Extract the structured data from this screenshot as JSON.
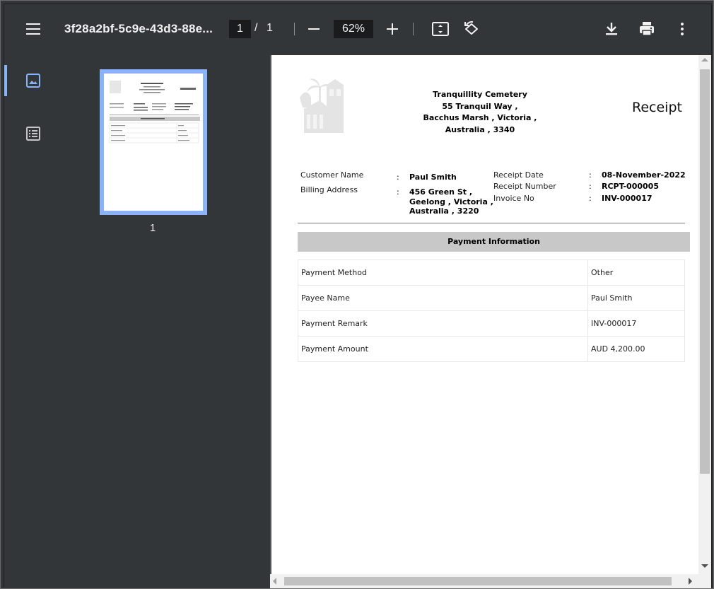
{
  "toolbar": {
    "title": "3f28a2bf-5c9e-43d3-88e...",
    "current_page": "1",
    "page_separator": "/",
    "total_pages": "1",
    "zoom": "62%"
  },
  "sidebar": {
    "thumbnail_page_number": "1"
  },
  "receipt": {
    "company_lines": [
      "Tranquillity Cemetery",
      "55 Tranquil Way ,",
      "Bacchus Marsh , Victoria ,",
      "Australia , 3340"
    ],
    "title": "Receipt",
    "customer_name_label": "Customer Name",
    "customer_name": "Paul Smith",
    "billing_address_label": "Billing Address",
    "billing_address_lines": [
      "456 Green St ,",
      "Geelong , Victoria ,",
      "Australia , 3220"
    ],
    "receipt_date_label": "Receipt Date",
    "receipt_date": "08-November-2022",
    "receipt_number_label": "Receipt Number",
    "receipt_number": "RCPT-000005",
    "invoice_no_label": "Invoice No",
    "invoice_no": "INV-000017",
    "colon": ":",
    "payment_info_heading": "Payment Information",
    "payment_rows": [
      {
        "label": "Payment Method",
        "value": "Other"
      },
      {
        "label": "Payee Name",
        "value": "Paul Smith"
      },
      {
        "label": "Payment Remark",
        "value": "INV-000017"
      },
      {
        "label": "Payment Amount",
        "value": "AUD 4,200.00"
      }
    ]
  },
  "colors": {
    "toolbar_bg": "#323639",
    "viewer_bg": "#525659",
    "thumbnail_highlight": "#8ab4f8",
    "payment_band": "#c8c8c8"
  },
  "icons": [
    "menu-icon",
    "fit-page-icon",
    "rotate-icon",
    "download-icon",
    "print-icon",
    "more-vert-icon",
    "thumbnail-view-icon",
    "outline-view-icon",
    "cemetery-logo"
  ]
}
